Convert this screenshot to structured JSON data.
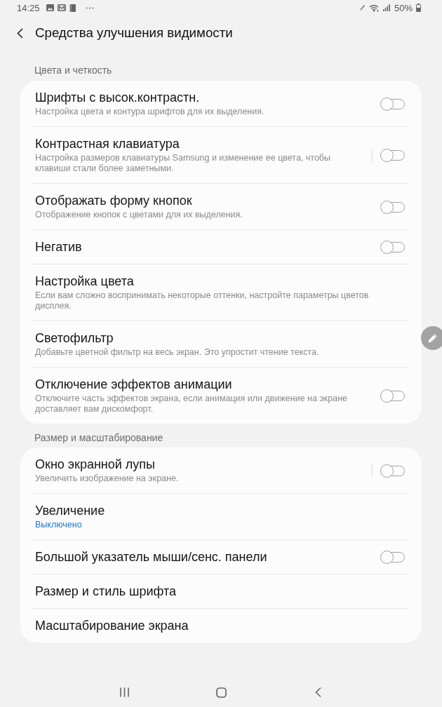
{
  "status_bar": {
    "time": "14:25",
    "battery": "50%"
  },
  "header": {
    "title": "Средства улучшения видимости"
  },
  "sections": [
    {
      "title": "Цвета и четкость",
      "items": [
        {
          "kind": "switch",
          "title": "Шрифты с высок.контрастн.",
          "summary": "Настройка цвета и контура шрифтов для их выделения.",
          "on": false
        },
        {
          "kind": "split_switch",
          "title": "Контрастная клавиатура",
          "summary": "Настройка размеров клавиатуры Samsung и изменение ее цвета, чтобы клавиши стали более заметными.",
          "on": false
        },
        {
          "kind": "switch",
          "title": "Отображать форму кнопок",
          "summary": "Отображение кнопок с цветами для их выделения.",
          "on": false
        },
        {
          "kind": "switch",
          "title": "Негатив",
          "on": false
        },
        {
          "kind": "link",
          "title": "Настройка цвета",
          "summary": "Если вам сложно воспринимать некоторые оттенки, настройте параметры цветов дисплея."
        },
        {
          "kind": "link",
          "title": "Светофильтр",
          "summary": "Добавьте цветной фильтр на весь экран. Это упростит чтение текста."
        },
        {
          "kind": "switch",
          "title": "Отключение эффектов анимации",
          "summary": "Отключите часть эффектов экрана, если анимация или движение на экране доставляет вам дискомфорт.",
          "on": false
        }
      ]
    },
    {
      "title": "Размер и масштабирование",
      "items": [
        {
          "kind": "split_switch",
          "title": "Окно экранной лупы",
          "summary": "Увеличить изображение на экране.",
          "on": false
        },
        {
          "kind": "link",
          "title": "Увеличение",
          "status": "Выключено"
        },
        {
          "kind": "switch",
          "title": "Большой указатель мыши/сенс. панели",
          "on": false
        },
        {
          "kind": "link",
          "title": "Размер и стиль шрифта"
        },
        {
          "kind": "link",
          "title": "Масштабирование экрана"
        }
      ]
    }
  ]
}
